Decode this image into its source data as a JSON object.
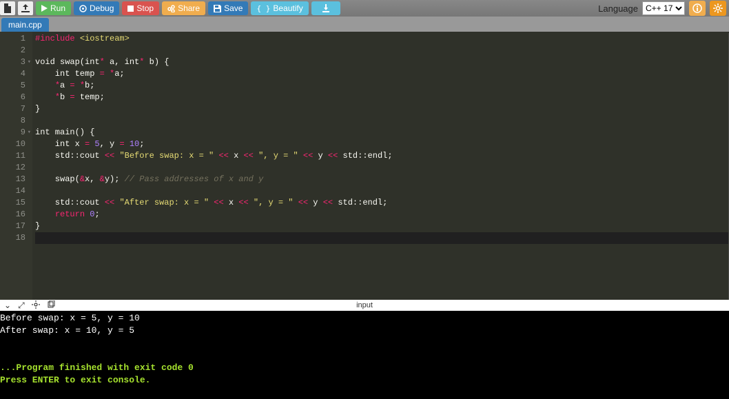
{
  "toolbar": {
    "run": "Run",
    "debug": "Debug",
    "stop": "Stop",
    "share": "Share",
    "save": "Save",
    "beautify": "Beautify",
    "language_label": "Language",
    "language_value": "C++ 17"
  },
  "tabs": [
    {
      "label": "main.cpp"
    }
  ],
  "editor": {
    "line_count": 18,
    "active_line": 18,
    "fold_lines": [
      3,
      9
    ],
    "code": [
      [
        {
          "c": "tok-red",
          "t": "#include"
        },
        {
          "t": " "
        },
        {
          "c": "tok-str",
          "t": "<iostream>"
        }
      ],
      [],
      [
        {
          "t": "void swap(int"
        },
        {
          "c": "tok-op",
          "t": "*"
        },
        {
          "t": " a, int"
        },
        {
          "c": "tok-op",
          "t": "*"
        },
        {
          "t": " b) {"
        }
      ],
      [
        {
          "t": "    int temp "
        },
        {
          "c": "tok-op",
          "t": "="
        },
        {
          "t": " "
        },
        {
          "c": "tok-op",
          "t": "*"
        },
        {
          "t": "a;"
        }
      ],
      [
        {
          "t": "    "
        },
        {
          "c": "tok-op",
          "t": "*"
        },
        {
          "t": "a "
        },
        {
          "c": "tok-op",
          "t": "="
        },
        {
          "t": " "
        },
        {
          "c": "tok-op",
          "t": "*"
        },
        {
          "t": "b;"
        }
      ],
      [
        {
          "t": "    "
        },
        {
          "c": "tok-op",
          "t": "*"
        },
        {
          "t": "b "
        },
        {
          "c": "tok-op",
          "t": "="
        },
        {
          "t": " temp;"
        }
      ],
      [
        {
          "t": "}"
        }
      ],
      [],
      [
        {
          "t": "int main() {"
        }
      ],
      [
        {
          "t": "    int x "
        },
        {
          "c": "tok-op",
          "t": "="
        },
        {
          "t": " "
        },
        {
          "c": "tok-num",
          "t": "5"
        },
        {
          "t": ", y "
        },
        {
          "c": "tok-op",
          "t": "="
        },
        {
          "t": " "
        },
        {
          "c": "tok-num",
          "t": "10"
        },
        {
          "t": ";"
        }
      ],
      [
        {
          "t": "    std::cout "
        },
        {
          "c": "tok-op",
          "t": "<<"
        },
        {
          "t": " "
        },
        {
          "c": "tok-str",
          "t": "\"Before swap: x = \""
        },
        {
          "t": " "
        },
        {
          "c": "tok-op",
          "t": "<<"
        },
        {
          "t": " x "
        },
        {
          "c": "tok-op",
          "t": "<<"
        },
        {
          "t": " "
        },
        {
          "c": "tok-str",
          "t": "\", y = \""
        },
        {
          "t": " "
        },
        {
          "c": "tok-op",
          "t": "<<"
        },
        {
          "t": " y "
        },
        {
          "c": "tok-op",
          "t": "<<"
        },
        {
          "t": " std::endl;"
        }
      ],
      [],
      [
        {
          "t": "    swap("
        },
        {
          "c": "tok-op",
          "t": "&"
        },
        {
          "t": "x, "
        },
        {
          "c": "tok-op",
          "t": "&"
        },
        {
          "t": "y); "
        },
        {
          "c": "tok-cmt",
          "t": "// Pass addresses of x and y"
        }
      ],
      [],
      [
        {
          "t": "    std::cout "
        },
        {
          "c": "tok-op",
          "t": "<<"
        },
        {
          "t": " "
        },
        {
          "c": "tok-str",
          "t": "\"After swap: x = \""
        },
        {
          "t": " "
        },
        {
          "c": "tok-op",
          "t": "<<"
        },
        {
          "t": " x "
        },
        {
          "c": "tok-op",
          "t": "<<"
        },
        {
          "t": " "
        },
        {
          "c": "tok-str",
          "t": "\", y = \""
        },
        {
          "t": " "
        },
        {
          "c": "tok-op",
          "t": "<<"
        },
        {
          "t": " y "
        },
        {
          "c": "tok-op",
          "t": "<<"
        },
        {
          "t": " std::endl;"
        }
      ],
      [
        {
          "t": "    "
        },
        {
          "c": "tok-kw",
          "t": "return"
        },
        {
          "t": " "
        },
        {
          "c": "tok-num",
          "t": "0"
        },
        {
          "t": ";"
        }
      ],
      [
        {
          "t": "}"
        }
      ],
      []
    ]
  },
  "io": {
    "title": "input"
  },
  "console": {
    "output": [
      "Before swap: x = 5, y = 10",
      "After swap: x = 10, y = 5",
      "",
      "",
      "...Program finished with exit code 0",
      "Press ENTER to exit console."
    ],
    "status_start_index": 4
  }
}
